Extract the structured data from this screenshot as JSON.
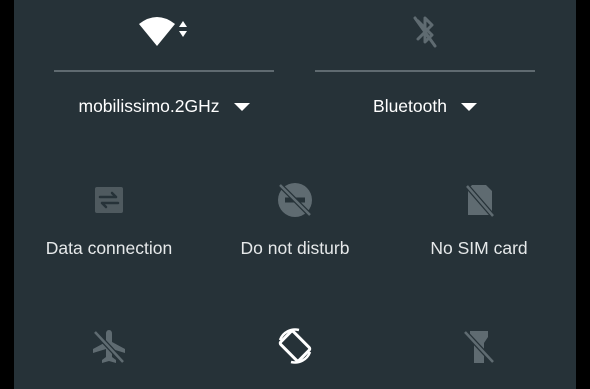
{
  "wifi": {
    "label": "mobilissimo.2GHz",
    "icon": "wifi-signal-icon",
    "state": "on"
  },
  "bluetooth": {
    "label": "Bluetooth",
    "icon": "bluetooth-off-icon",
    "state": "off"
  },
  "tiles": [
    {
      "label": "Data connection",
      "icon": "data-connection-icon",
      "state": "off"
    },
    {
      "label": "Do not disturb",
      "icon": "do-not-disturb-off-icon",
      "state": "off"
    },
    {
      "label": "No SIM card",
      "icon": "no-sim-card-icon",
      "state": "off"
    },
    {
      "label": "",
      "icon": "airplane-mode-off-icon",
      "state": "off"
    },
    {
      "label": "",
      "icon": "auto-rotate-icon",
      "state": "on"
    },
    {
      "label": "",
      "icon": "flashlight-off-icon",
      "state": "off"
    }
  ],
  "colors": {
    "panel_background": "#263238",
    "icon_active": "#ffffff",
    "icon_inactive": "#5f6b71",
    "divider": "#5f6a70"
  }
}
